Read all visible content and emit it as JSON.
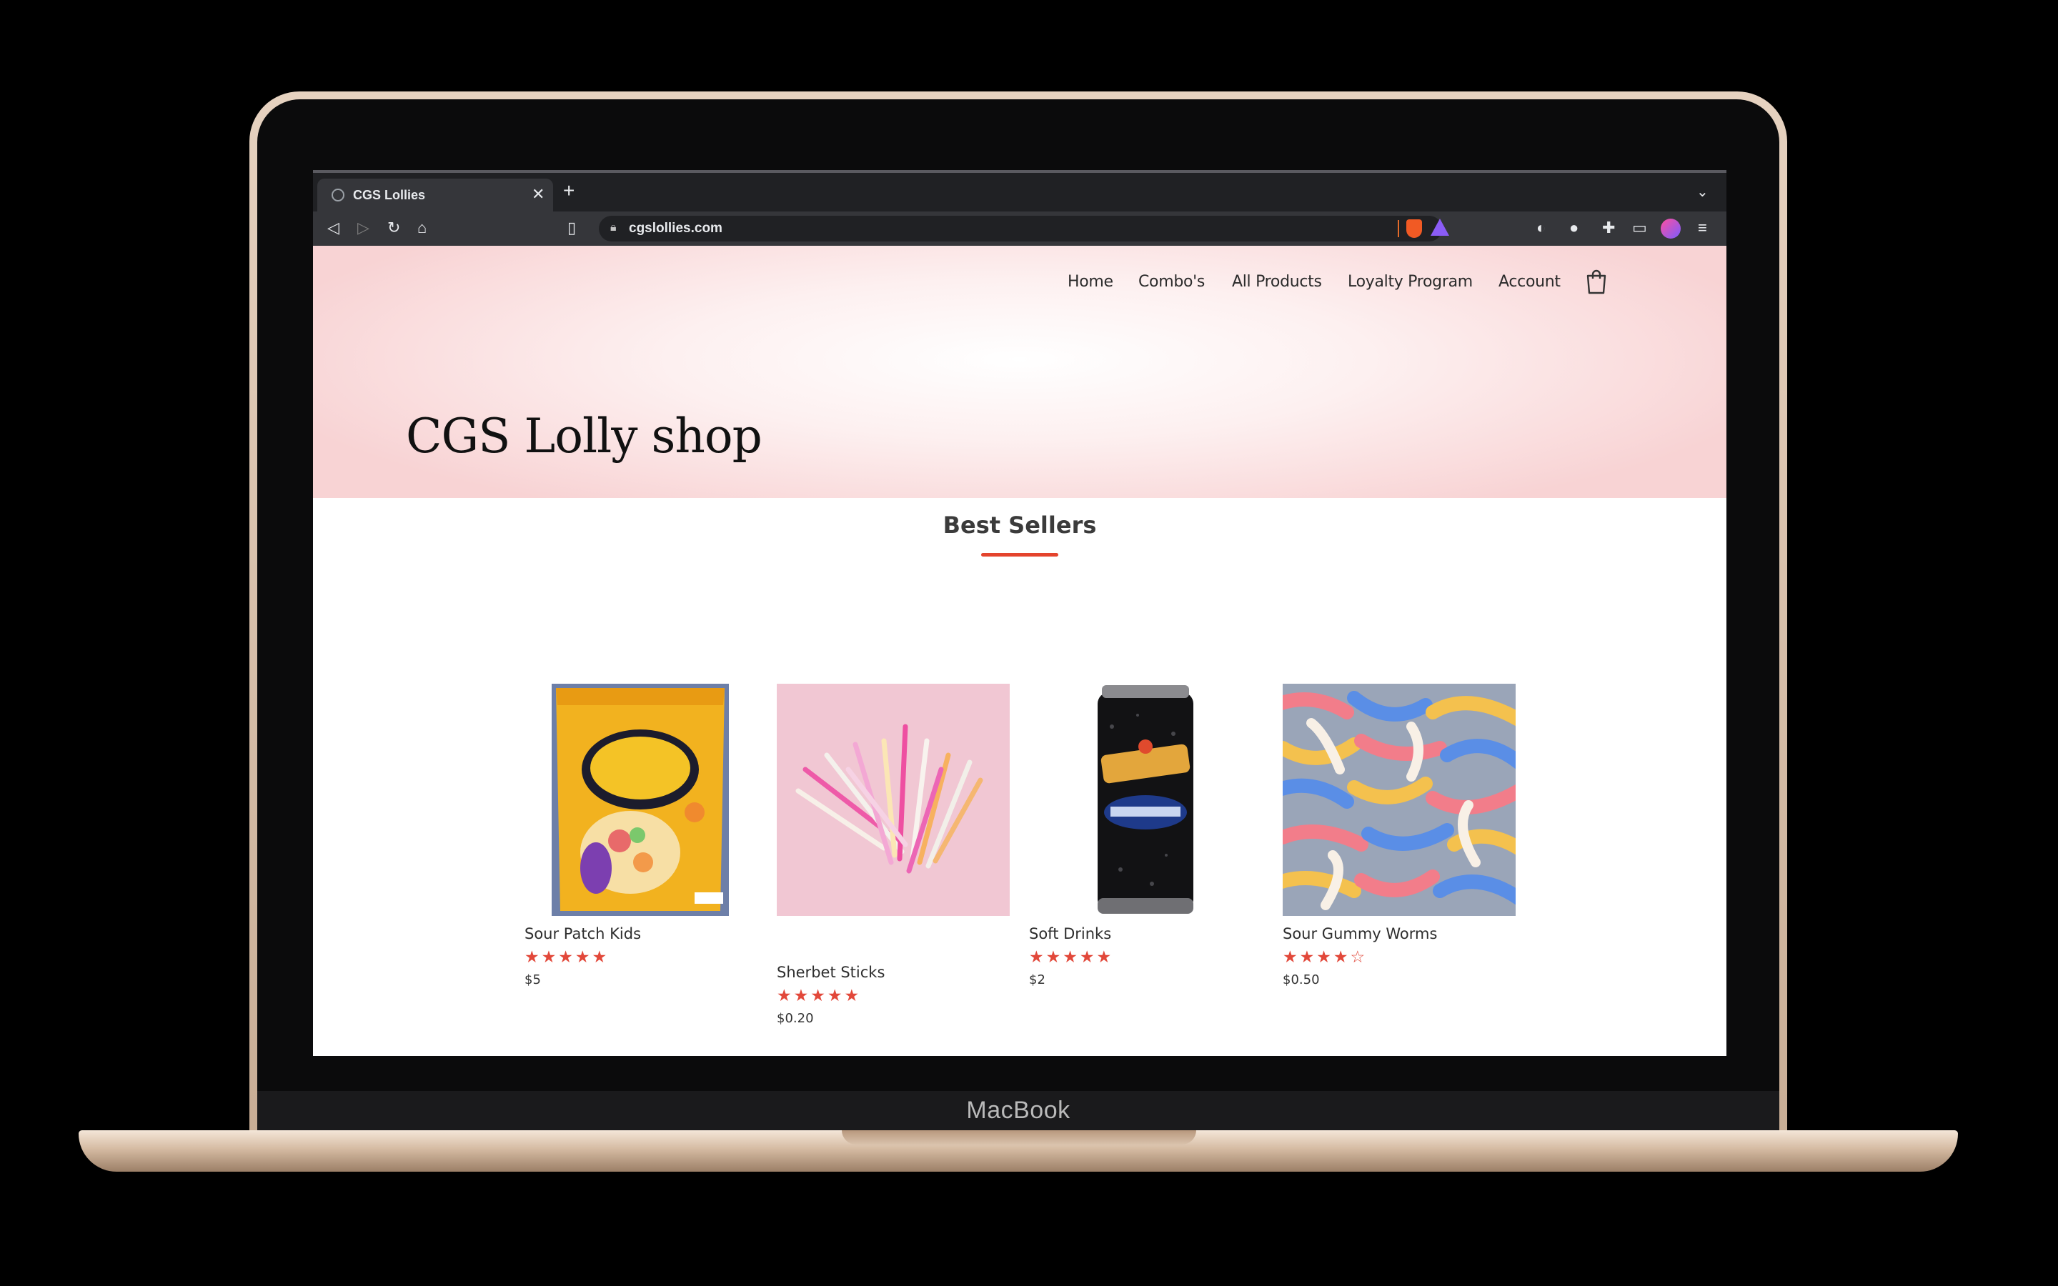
{
  "device": {
    "brand": "MacBook"
  },
  "browser": {
    "tab_title": "CGS Lollies",
    "new_tab_icon": "plus-icon",
    "url": "cgslollies.com"
  },
  "site": {
    "nav": [
      "Home",
      "Combo's",
      "All Products",
      "Loyalty Program",
      "Account"
    ],
    "cart_icon": "shopping-bag-icon",
    "hero_title": "CGS Lolly shop",
    "section_title": "Best Sellers",
    "accent_color": "#e4442d",
    "products": [
      {
        "name": "Sour Patch Kids",
        "rating": 5,
        "rating_display": "★★★★★",
        "price": "$5"
      },
      {
        "name": "Sherbet Sticks",
        "rating": 5,
        "rating_display": "★★★★★",
        "price": "$0.20"
      },
      {
        "name": "Soft Drinks",
        "rating": 5,
        "rating_display": "★★★★★",
        "price": "$2"
      },
      {
        "name": "Sour Gummy Worms",
        "rating": 4,
        "rating_display": "★★★★☆",
        "price": "$0.50"
      }
    ]
  }
}
